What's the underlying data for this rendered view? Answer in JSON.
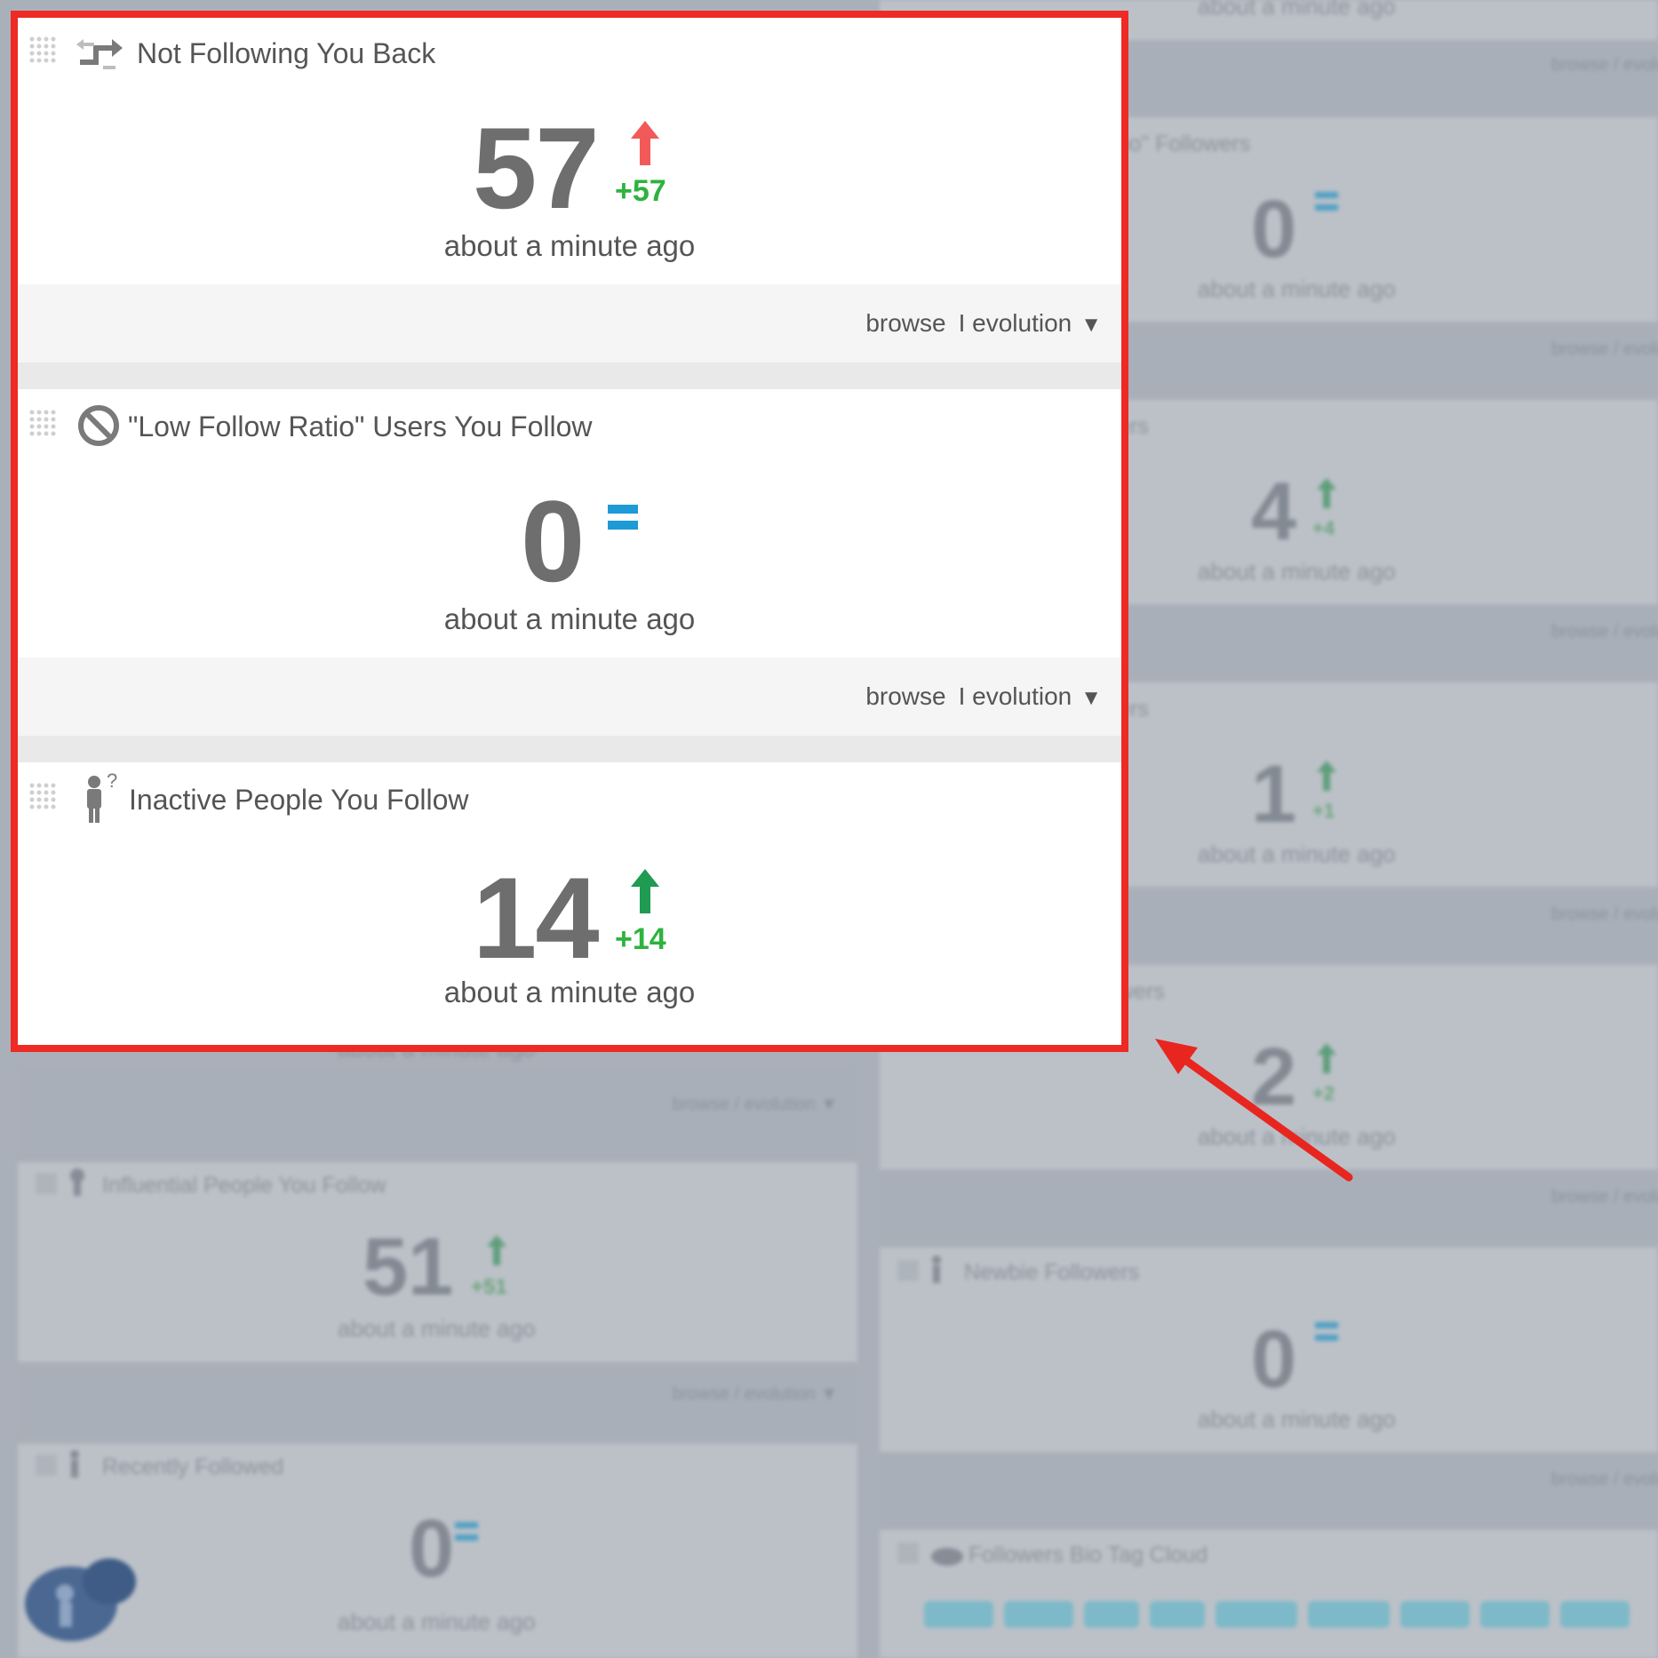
{
  "highlighted": {
    "widgets": [
      {
        "title": "Not Following You Back",
        "icon": "unfollow-arrows-icon",
        "value": "57",
        "trend": "up",
        "trend_color": "#f25a5a",
        "delta": "+57",
        "updated": "about a minute ago",
        "links": {
          "browse": "browse",
          "evolution": "I evolution"
        }
      },
      {
        "title": "\"Low Follow Ratio\" Users You Follow",
        "icon": "no-entry-icon",
        "value": "0",
        "trend": "equal",
        "trend_color": "#1e9ad6",
        "delta": "",
        "updated": "about a minute ago",
        "links": {
          "browse": "browse",
          "evolution": "I evolution"
        }
      },
      {
        "title": "Inactive People You Follow",
        "icon": "inactive-person-icon",
        "value": "14",
        "trend": "up",
        "trend_color": "#1f9b52",
        "delta": "+14",
        "updated": "about a minute ago"
      }
    ]
  },
  "background": {
    "left": [
      {
        "updated": "about a minute ago",
        "links": "browse  / evolution ▼"
      },
      {
        "title": "Influential People You Follow",
        "value": "51",
        "delta": "+51",
        "updated": "about a minute ago",
        "links": "browse  / evolution ▼"
      },
      {
        "title": "Recently Followed",
        "value": "0",
        "updated": "about a minute ago"
      }
    ],
    "right": [
      {
        "updated": "about a minute ago",
        "links": "browse  / evolutio"
      },
      {
        "title": "tio\" Followers",
        "value": "0",
        "updated": "about a minute ago",
        "links": "browse  / evolutio"
      },
      {
        "title": "ers",
        "value": "4",
        "delta": "+4",
        "updated": "about a minute ago",
        "links": "browse  / evolutio"
      },
      {
        "title": "ers",
        "value": "1",
        "delta": "+1",
        "updated": "about a minute ago",
        "links": "browse  / evolutio"
      },
      {
        "title": "wers",
        "value": "2",
        "delta": "+2",
        "updated": "about a minute ago",
        "links": "browse  / evolutio"
      },
      {
        "title": "Newbie Followers",
        "value": "0",
        "updated": "about a minute ago",
        "links": "browse  / evolutio"
      },
      {
        "title": "Followers Bio Tag Cloud"
      }
    ]
  },
  "colors": {
    "highlight_border": "#ee2a24",
    "delta_green": "#2db33e",
    "equal_blue": "#1e9ad6"
  }
}
